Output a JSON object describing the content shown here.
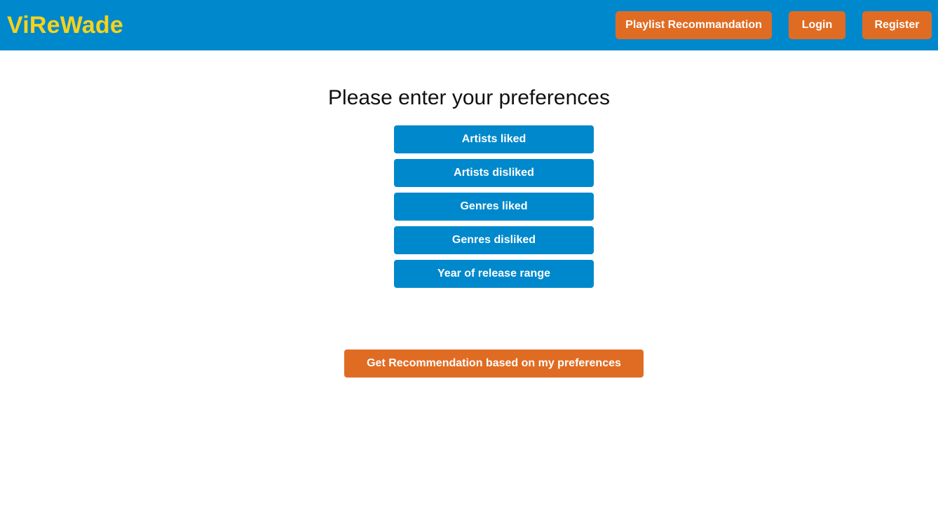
{
  "navbar": {
    "brand": "ViReWade",
    "links": {
      "playlist": "Playlist Recommandation",
      "login": "Login",
      "register": "Register"
    }
  },
  "main": {
    "title": "Please enter your preferences",
    "preferences": [
      "Artists liked",
      "Artists disliked",
      "Genres liked",
      "Genres disliked",
      "Year of release range"
    ],
    "submit_label": "Get Recommendation based on my preferences"
  },
  "colors": {
    "navbar_bg": "#0088cc",
    "brand": "#f7d21b",
    "accent_orange": "#e06c23",
    "primary_blue": "#0088cc"
  }
}
